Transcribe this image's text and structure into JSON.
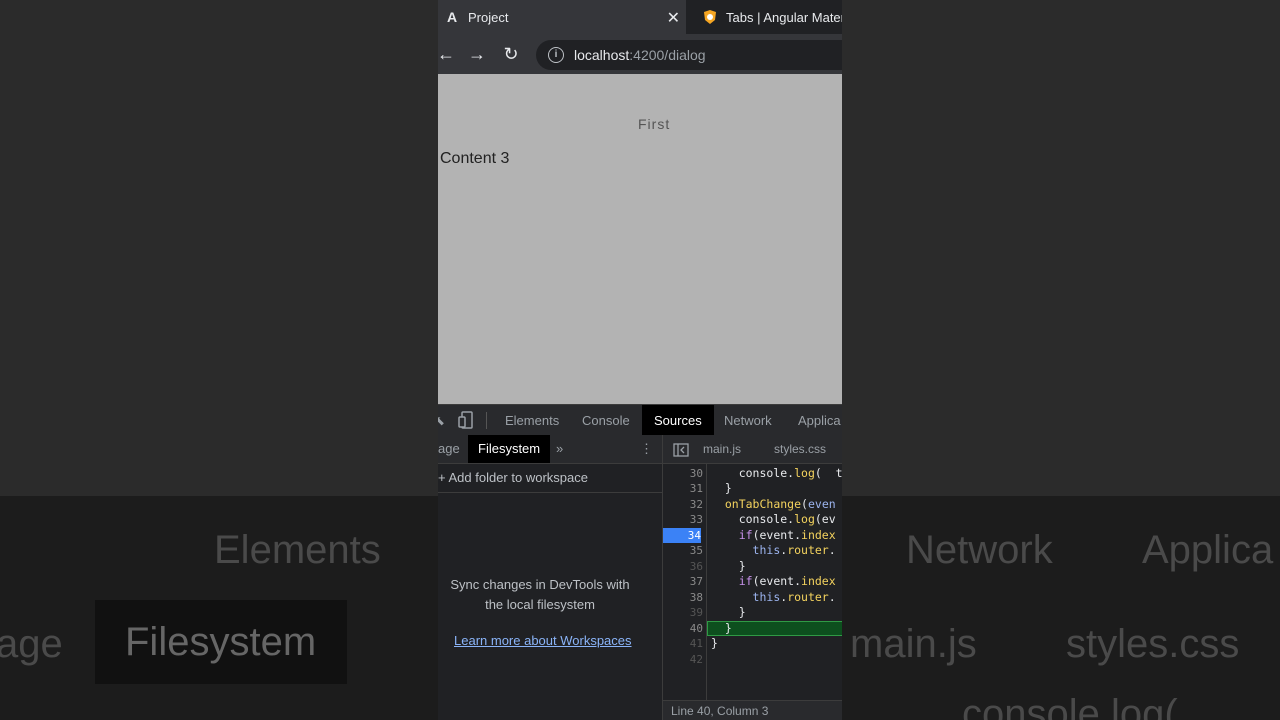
{
  "browser": {
    "tabs": [
      {
        "label": "Project",
        "favicon": "angular-icon"
      },
      {
        "label": "Tabs | Angular Mater",
        "favicon": "shield-icon"
      }
    ],
    "url_host": "localhost",
    "url_path": ":4200/dialog"
  },
  "page": {
    "tab_label": "First",
    "content": "Content 3"
  },
  "devtools": {
    "tabs": [
      "Elements",
      "Console",
      "Sources",
      "Network",
      "Applica"
    ],
    "active_tab": "Sources",
    "navigator_tabs": [
      "age",
      "Filesystem"
    ],
    "add_folder": "Add folder to workspace",
    "sync_line1": "Sync changes in DevTools with",
    "sync_line2": "the local filesystem",
    "learn_more": "Learn more about Workspaces",
    "files": [
      "main.js",
      "styles.css"
    ],
    "line_numbers": [
      "30",
      "31",
      "32",
      "33",
      "34",
      "35",
      "36",
      "37",
      "38",
      "39",
      "40",
      "41",
      "42"
    ],
    "status": "Line 40, Column 3"
  },
  "background": {
    "elements": "Elements",
    "network": "Network",
    "applica": "Applica",
    "age": "age",
    "filesystem": "Filesystem",
    "mainjs": "main.js",
    "stylescss": "styles.css",
    "console_log": "console.log("
  }
}
